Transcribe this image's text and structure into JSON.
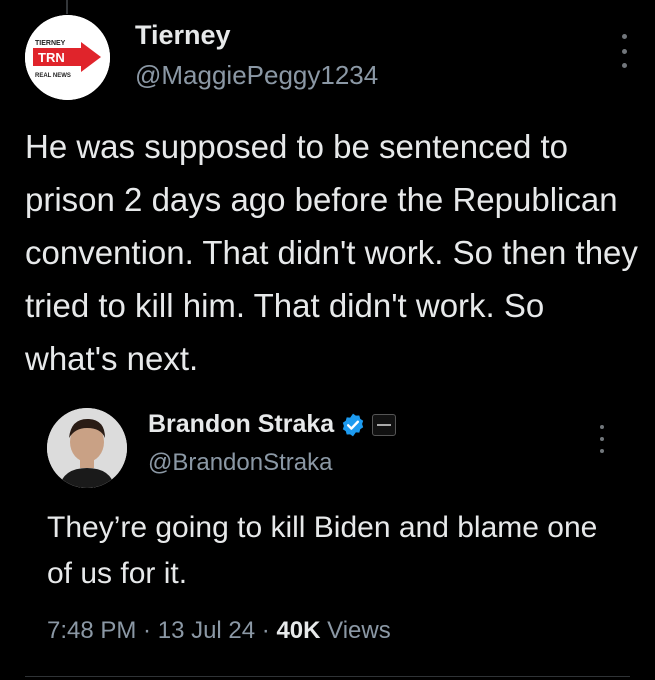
{
  "tweet": {
    "author": {
      "name": "Tierney",
      "handle": "@MaggiePeggy1234"
    },
    "avatar_logo": {
      "top": "TIERNEY",
      "mid": "TRN",
      "bottom": "REAL NEWS"
    },
    "text": "He was supposed to be sentenced to prison 2 days ago before the Republican convention. That didn't work. So then they tried to kill him. That didn't work. So what's next."
  },
  "quote": {
    "author": {
      "name": "Brandon Straka",
      "handle": "@BrandonStraka"
    },
    "text": "They’re going to kill Biden and blame one of us for it.",
    "meta": {
      "time": "7:48 PM",
      "sep": " · ",
      "date": "13 Jul 24",
      "views_count": "40K",
      "views_label": " Views"
    }
  },
  "icons": {
    "more": "more-horizontal-icon",
    "verified": "verified-badge-icon",
    "affiliation": "affiliation-badge-icon"
  },
  "colors": {
    "background": "#000000",
    "text": "#e7e9ea",
    "secondary": "#8b98a5",
    "verified": "#1d9bf0",
    "brand_red": "#e0242b"
  }
}
